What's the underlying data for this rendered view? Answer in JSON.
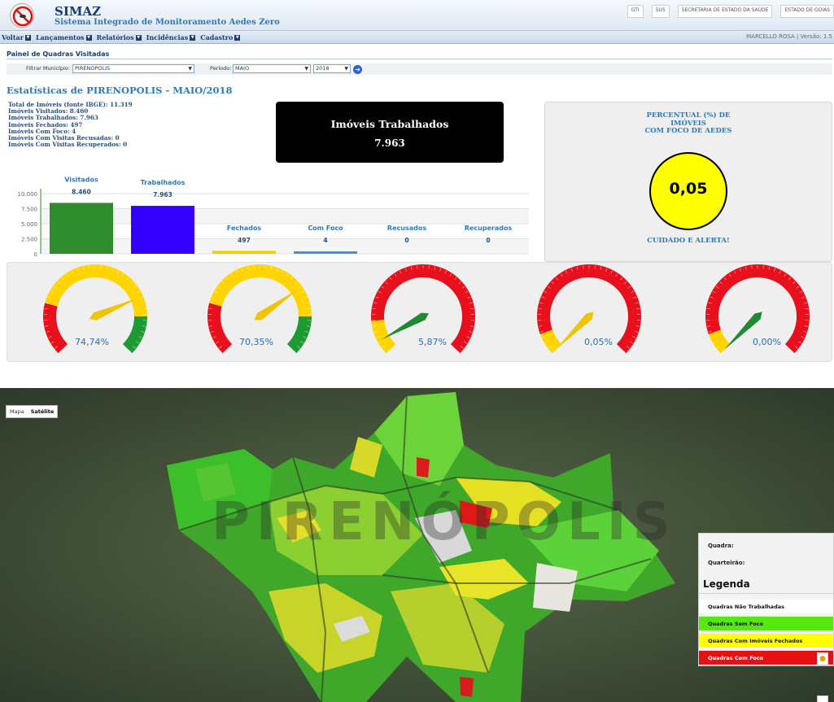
{
  "header": {
    "app_title": "SIMAZ",
    "app_subtitle": "Sistema Integrado de Monitoramento Aedes Zero",
    "partner_logos": [
      "GTI",
      "SUS",
      "SECRETARIA DE ESTADO DA SAÚDE",
      "ESTADO DE GOIÁS"
    ]
  },
  "menu": {
    "items": [
      "Voltar",
      "Lançamentos",
      "Relatórios",
      "Incidências",
      "Cadastro"
    ],
    "user_info": "MARCELLO ROSA | Versão: 1.5"
  },
  "panel": {
    "title": "Painel de Quadras Visitadas",
    "municipio_label": "Filtrar Município:",
    "municipio_value": "PIRENOPOLIS",
    "periodo_label": "Período:",
    "periodo_value": "MAIO",
    "ano_value": "2018"
  },
  "stats": {
    "heading": "Estatísticas de PIRENOPOLIS - MAIO/2018",
    "lines": [
      "Total de Imóveis (fonte IBGE): 11.319",
      "Imóveis Visitados: 8.460",
      "Imóveis Trabalhados: 7.963",
      "Imóveis Fechados: 497",
      "Imóveis Com Foco: 4",
      "Imóveis Com Visitas Recusadas: 0",
      "Imóveis Com Visitas Recuperados: 0"
    ]
  },
  "highlight": {
    "title": "Imóveis Trabalhados",
    "value": "7.963"
  },
  "percentual": {
    "title_lines": [
      "PERCENTUAL (%) DE",
      "IMÓVEIS",
      "COM FOCO DE AEDES"
    ],
    "value": "0,05",
    "alert": "CUIDADO E ALERTA!",
    "circle_color": "#ffff00"
  },
  "chart_data": {
    "type": "bar",
    "categories": [
      "Visitados",
      "Trabalhados",
      "Fechados",
      "Com Foco",
      "Recusados",
      "Recuperados"
    ],
    "values": [
      8460,
      7963,
      497,
      4,
      0,
      0
    ],
    "value_labels": [
      "8.460",
      "7.963",
      "497",
      "4",
      "0",
      "0"
    ],
    "colors": [
      "#2e8b2e",
      "#3300ff",
      "#f5d000",
      "#4a90d9",
      "#4a90d9",
      "#4a90d9"
    ],
    "yticks": [
      "0",
      "2.500",
      "5.000",
      "7.500",
      "10.000"
    ],
    "ylim": [
      0,
      10000
    ],
    "grid": true
  },
  "gauges": [
    {
      "label": "74,74%",
      "value": 74.74
    },
    {
      "label": "70,35%",
      "value": 70.35
    },
    {
      "label": "5,87%",
      "value": 5.87
    },
    {
      "label": "0,05%",
      "value": 0.05
    },
    {
      "label": "0,00%",
      "value": 0.0
    }
  ],
  "gauge_colors": {
    "red": "#e8101c",
    "yellow": "#ffd400",
    "green": "#1e9a33",
    "needle_yellow": "#f0c400",
    "needle_green": "#1f8a30"
  },
  "map": {
    "buttons": [
      "Mapa",
      "Satélite"
    ],
    "active_button": "Satélite",
    "background_text": "PIRENÓPOLIS",
    "legend": {
      "quadra_label": "Quadra:",
      "quarteirao_label": "Quarteirão:",
      "title": "Legenda",
      "items": [
        {
          "label": "Quadras Não Trabalhadas",
          "color": "#ffffff"
        },
        {
          "label": "Quadras Sem Foco",
          "color": "#56e80f"
        },
        {
          "label": "Quadras Com Imóveis Fechados",
          "color": "#ffff00"
        },
        {
          "label": "Quadras Com Foco",
          "color": "#e81111"
        }
      ]
    }
  }
}
